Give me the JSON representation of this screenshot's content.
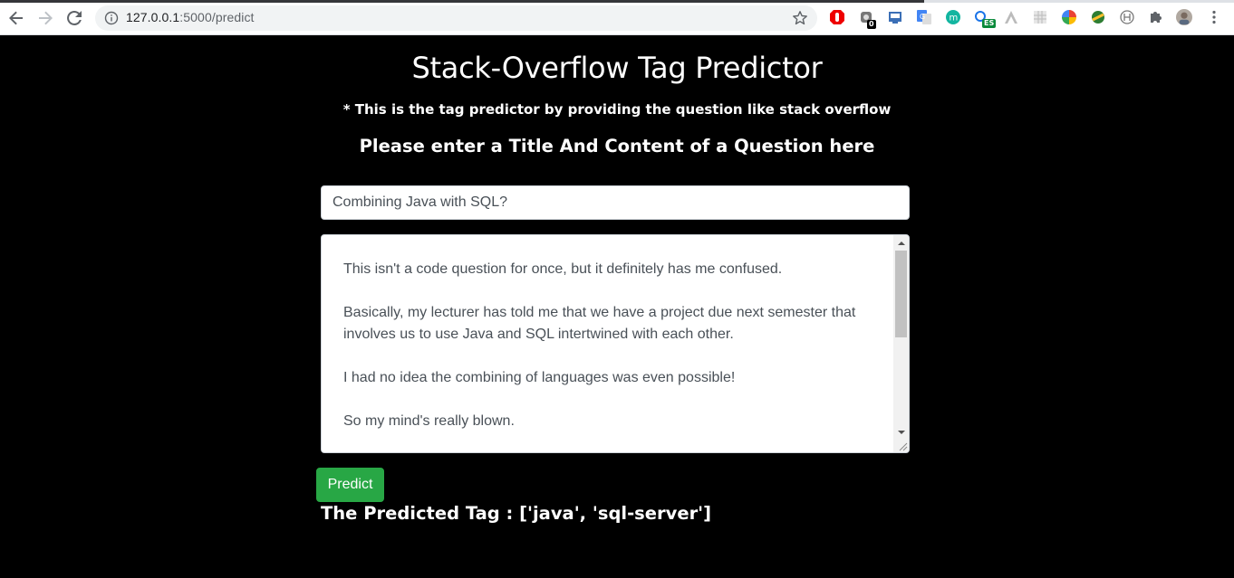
{
  "browser": {
    "url_host": "127.0.0.1",
    "url_path": ":5000/predict",
    "extension_badges": {
      "ext2": "0",
      "ext7": "ES"
    }
  },
  "page": {
    "title": "Stack-Overflow Tag Predictor",
    "subtitle": "* This is the tag predictor by providing the question like stack overflow",
    "prompt": "Please enter a Title And Content of a Question here",
    "title_input_value": "Combining Java with SQL?",
    "content_paragraphs": [
      "This isn't a code question for once, but it definitely has me confused.",
      "Basically, my lecturer has told me that we have a project due next semester that involves us to use Java and SQL intertwined with each other.",
      "I had no idea the combining of languages was even possible!",
      "So my mind's really blown."
    ],
    "predict_button": "Predict",
    "result_text": "The Predicted Tag : ['java', 'sql-server']"
  },
  "colors": {
    "background": "#000000",
    "button": "#28a745"
  }
}
